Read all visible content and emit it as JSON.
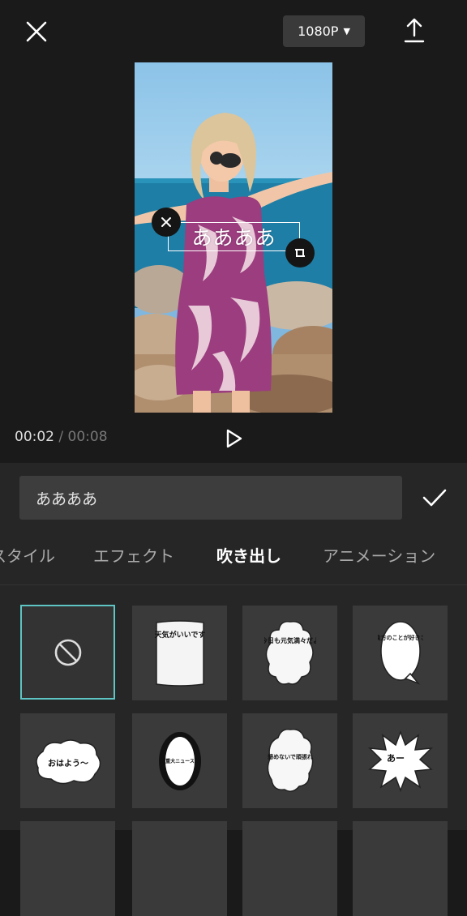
{
  "toolbar": {
    "close_icon": "close-icon",
    "resolution_label": "1080P",
    "export_icon": "export-icon"
  },
  "preview": {
    "overlay_text": "ああああ"
  },
  "playback": {
    "current_time": "00:02",
    "separator": "/",
    "total_time": "00:08"
  },
  "editor": {
    "text_value": "ああああ",
    "confirm_icon": "checkmark-icon"
  },
  "tabs": [
    {
      "label": "スタイル",
      "active": false
    },
    {
      "label": "エフェクト",
      "active": false
    },
    {
      "label": "吹き出し",
      "active": true
    },
    {
      "label": "アニメーション",
      "active": false
    }
  ],
  "bubbles": {
    "none_icon": "no-entry-icon",
    "items": [
      {
        "text": "天気がいいです"
      },
      {
        "text": "今日も元気満々だよ"
      },
      {
        "text": "貴方のことが好きさ"
      },
      {
        "text": "おはよう〜"
      },
      {
        "text": "重大ニュース"
      },
      {
        "text": "諦めないで頑張れ"
      },
      {
        "text": "あー"
      }
    ]
  },
  "colors": {
    "background": "#1a1a1a",
    "panel": "#262626",
    "selection_accent": "#5fc4c4",
    "dress": "#9b3d7e"
  }
}
